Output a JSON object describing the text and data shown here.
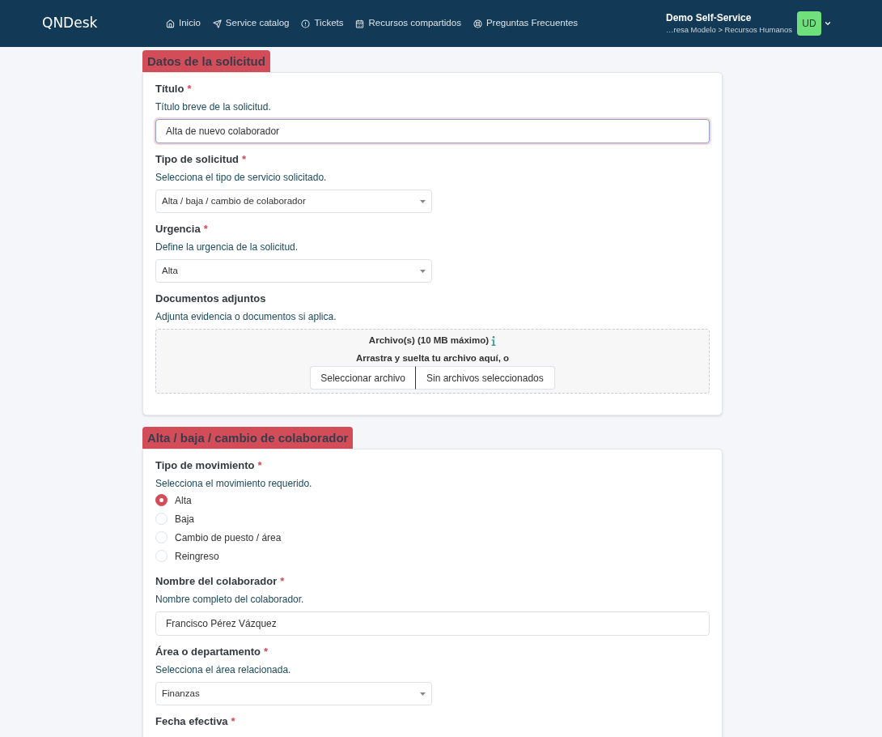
{
  "navbar": {
    "logo": "QNDesk",
    "nav_items": [
      {
        "label": "Inicio"
      },
      {
        "label": "Service catalog"
      },
      {
        "label": "Tickets"
      },
      {
        "label": "Recursos compartidos"
      },
      {
        "label": "Preguntas Frecuentes"
      }
    ],
    "user": {
      "name": "Demo Self-Service",
      "path": "…resa Modelo > Recursos Humanos",
      "initials": "UD"
    }
  },
  "sections": [
    {
      "title": "Datos de la solicitud",
      "fields": [
        {
          "kind": "text",
          "label": "Título",
          "required_mark": "*",
          "help": "Título breve de la solicitud.",
          "input": {
            "value": "Alta de nuevo colaborador",
            "focused": true
          }
        },
        {
          "kind": "select",
          "label": "Tipo de solicitud",
          "required_mark": "*",
          "help": "Selecciona el tipo de servicio solicitado.",
          "select": {
            "value": "Alta / baja / cambio de colaborador"
          }
        },
        {
          "kind": "select",
          "label": "Urgencia",
          "required_mark": "*",
          "help": "Define la urgencia de la solicitud.",
          "select": {
            "value": "Alta"
          }
        },
        {
          "kind": "file",
          "label": "Documentos adjuntos",
          "help": "Adjunta evidencia o documentos si aplica.",
          "dropzone": {
            "title": "Archivo(s) (10 MB máximo)",
            "text": "Arrastra y suelta tu archivo aquí, o",
            "button": "Seleccionar archivo",
            "status": "Sin archivos seleccionados"
          }
        }
      ]
    },
    {
      "title": "Alta / baja / cambio de colaborador",
      "fields": [
        {
          "kind": "radio",
          "label": "Tipo de movimiento",
          "required_mark": "*",
          "help": "Selecciona el movimiento requerido.",
          "options": [
            {
              "label": "Alta",
              "selected": true
            },
            {
              "label": "Baja",
              "selected": false
            },
            {
              "label": "Cambio de puesto / área",
              "selected": false
            },
            {
              "label": "Reingreso",
              "selected": false
            }
          ]
        },
        {
          "kind": "text",
          "label": "Nombre del colaborador",
          "required_mark": "*",
          "help": "Nombre completo del colaborador.",
          "input": {
            "value": "Francisco Pérez Vázquez",
            "focused": false
          }
        },
        {
          "kind": "select",
          "label": "Área o departamento",
          "required_mark": "*",
          "help": "Selecciona el área relacionada.",
          "select": {
            "value": "Finanzas"
          }
        },
        {
          "kind": "date",
          "label": "Fecha efectiva",
          "required_mark": "*"
        }
      ]
    }
  ]
}
